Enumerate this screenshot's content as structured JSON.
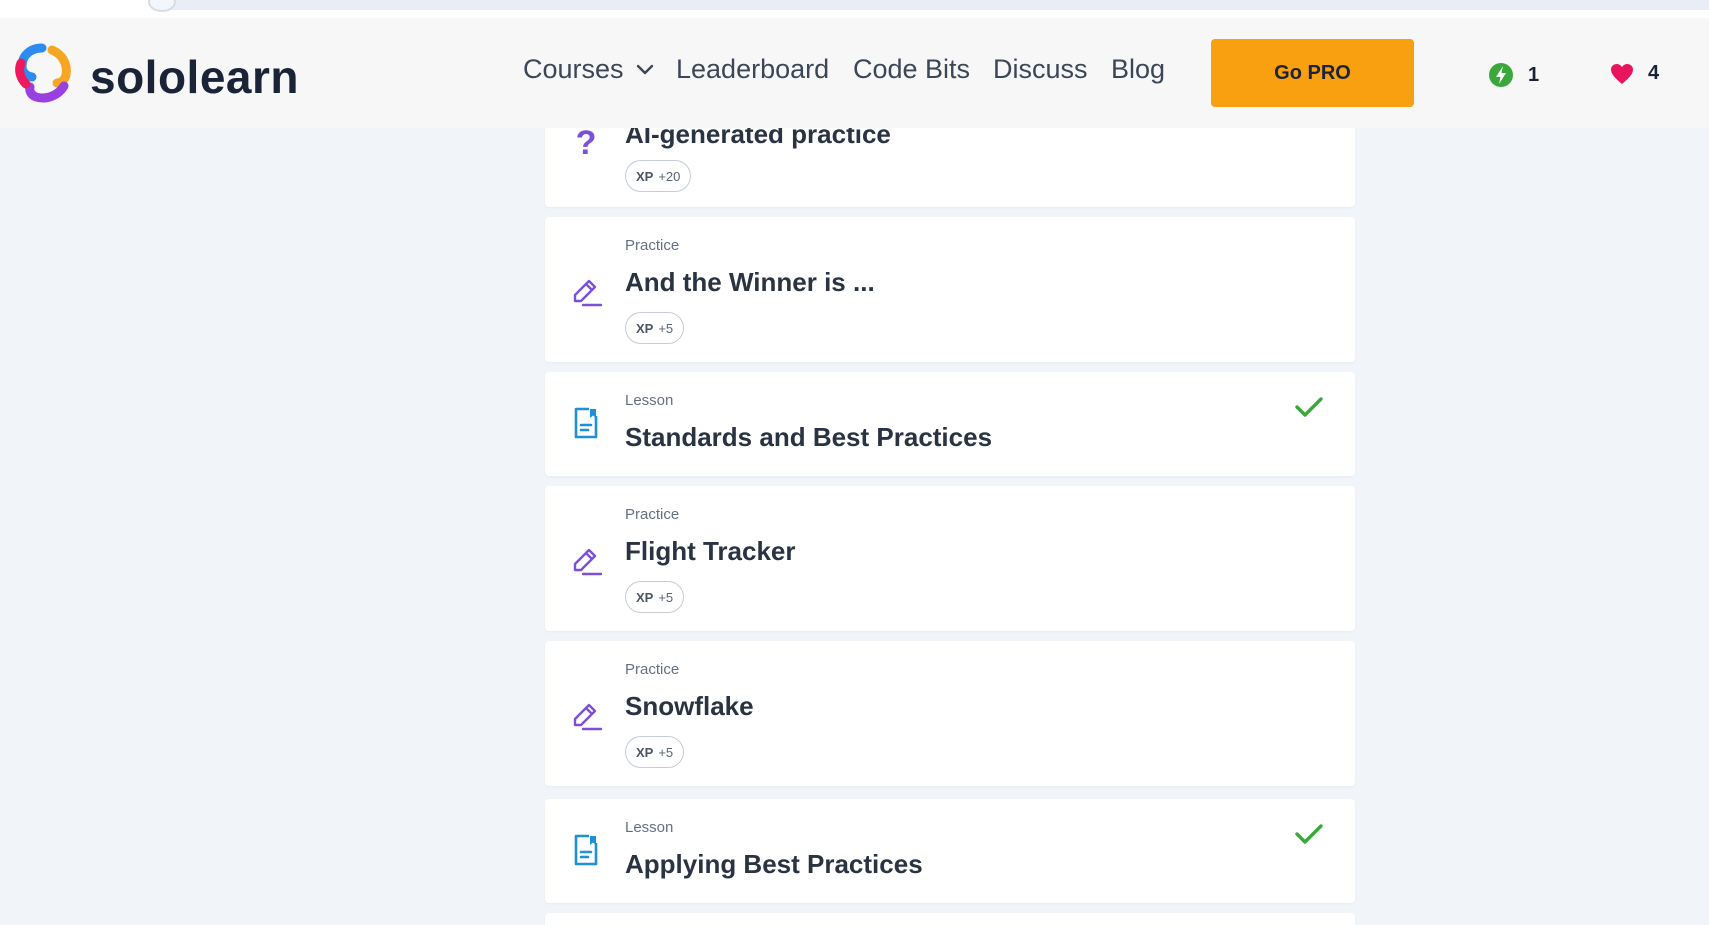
{
  "header": {
    "brand": "sololearn",
    "nav": {
      "courses": "Courses",
      "leaderboard": "Leaderboard",
      "code_bits": "Code Bits",
      "discuss": "Discuss",
      "blog": "Blog"
    },
    "go_pro": "Go PRO",
    "streak_count": "1",
    "hearts_count": "4"
  },
  "items": [
    {
      "kind": "",
      "title": "AI-generated practice",
      "xp_label": "XP",
      "xp_value": "+20",
      "icon": "question-icon",
      "completed": false
    },
    {
      "kind": "Practice",
      "title": "And the Winner is ...",
      "xp_label": "XP",
      "xp_value": "+5",
      "icon": "pencil-icon",
      "completed": false
    },
    {
      "kind": "Lesson",
      "title": "Standards and Best Practices",
      "icon": "lesson-icon",
      "completed": true
    },
    {
      "kind": "Practice",
      "title": "Flight Tracker",
      "xp_label": "XP",
      "xp_value": "+5",
      "icon": "pencil-icon",
      "completed": false
    },
    {
      "kind": "Practice",
      "title": "Snowflake",
      "xp_label": "XP",
      "xp_value": "+5",
      "icon": "pencil-icon",
      "completed": false
    },
    {
      "kind": "Lesson",
      "title": "Applying Best Practices",
      "icon": "lesson-icon",
      "completed": true
    }
  ],
  "colors": {
    "accent_orange": "#f9a010",
    "practice_purple": "#7b4fd8",
    "lesson_blue": "#1e8fd9",
    "check_green": "#3aa83a",
    "heart_red": "#e8155e"
  }
}
